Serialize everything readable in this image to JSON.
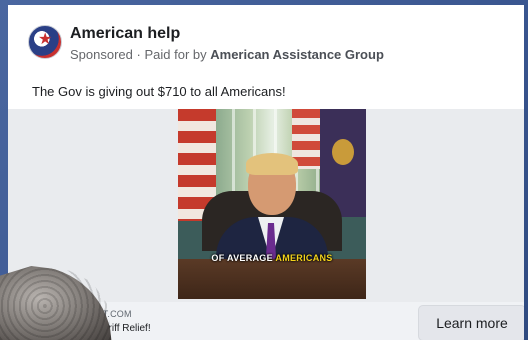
{
  "ad": {
    "page_name": "American help",
    "sponsored": "Sponsored",
    "paid_for_prefix": "Paid for by",
    "advertiser": "American Assistance Group",
    "primary_text": "The Gov is giving out $710 to all Americans!",
    "video": {
      "caption_part1": "OF AVERAGE",
      "caption_part2": "AMERICANS"
    },
    "footer": {
      "domain": "NT.COM",
      "headline": "Tariff Relief!",
      "cta_label": "Learn more"
    }
  },
  "colors": {
    "background_blue": "#3d5a92",
    "card": "#ffffff",
    "footer_bg": "#f0f2f5",
    "caption_highlight": "#f2d21b"
  }
}
